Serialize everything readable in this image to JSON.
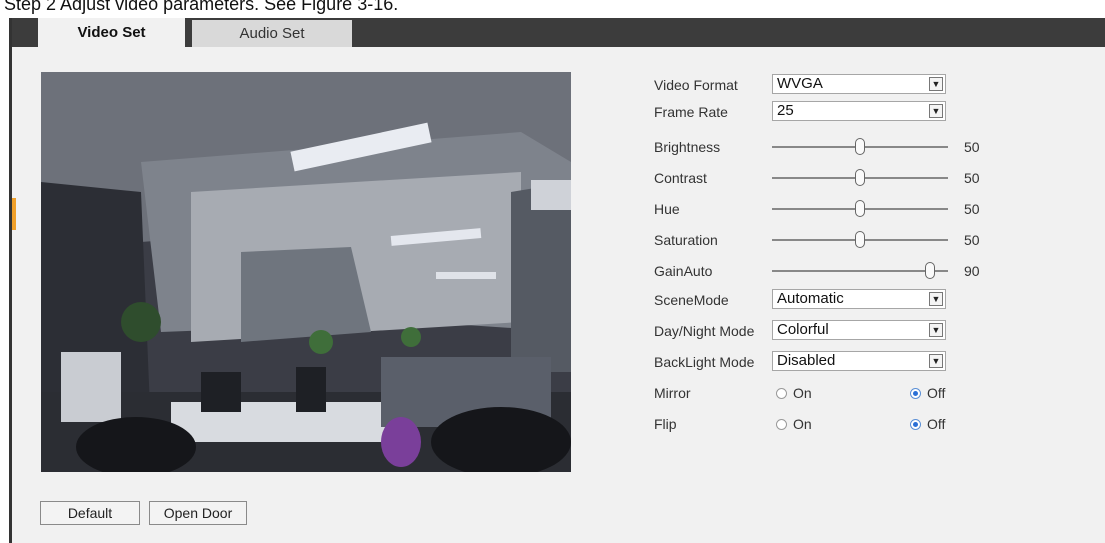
{
  "step_text": "Step 2  Adjust video parameters. See Figure 3-16.",
  "tabs": [
    {
      "label": "Video Set",
      "active": true
    },
    {
      "label": "Audio Set",
      "active": false
    }
  ],
  "settings": {
    "video_format": {
      "label": "Video Format",
      "value": "WVGA"
    },
    "frame_rate": {
      "label": "Frame Rate",
      "value": "25"
    },
    "brightness": {
      "label": "Brightness",
      "value": "50",
      "level": 0.5
    },
    "contrast": {
      "label": "Contrast",
      "value": "50",
      "level": 0.5
    },
    "hue": {
      "label": "Hue",
      "value": "50",
      "level": 0.5
    },
    "saturation": {
      "label": "Saturation",
      "value": "50",
      "level": 0.5
    },
    "gain_auto": {
      "label": "GainAuto",
      "value": "90",
      "level": 0.9
    },
    "scene_mode": {
      "label": "SceneMode",
      "value": "Automatic"
    },
    "day_night_mode": {
      "label": "Day/Night Mode",
      "value": "Colorful"
    },
    "backlight_mode": {
      "label": "BackLight Mode",
      "value": "Disabled"
    },
    "mirror": {
      "label": "Mirror",
      "on_label": "On",
      "off_label": "Off",
      "selected": "Off"
    },
    "flip": {
      "label": "Flip",
      "on_label": "On",
      "off_label": "Off",
      "selected": "Off"
    }
  },
  "buttons": {
    "default_label": "Default",
    "open_door_label": "Open Door"
  },
  "colors": {
    "tab_bar": "#3c3c3c",
    "panel": "#f1f1f1",
    "accent": "#f0a02a",
    "radio_selected": "#2a6fd6"
  }
}
